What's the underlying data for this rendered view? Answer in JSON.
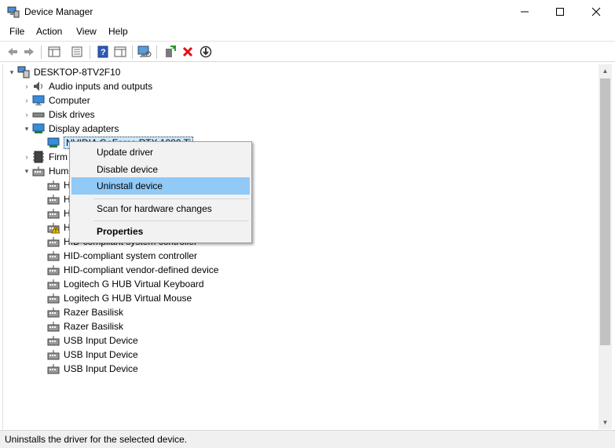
{
  "window": {
    "title": "Device Manager"
  },
  "menubar": {
    "items": [
      "File",
      "Action",
      "View",
      "Help"
    ]
  },
  "toolbar": {
    "buttons": [
      "back-arrow-icon",
      "forward-arrow-icon",
      "show-hide-console-tree-icon",
      "properties-icon",
      "help-icon",
      "action-pane-icon",
      "scan-hardware-icon",
      "update-driver-icon",
      "uninstall-icon",
      "disable-device-icon"
    ]
  },
  "tree": {
    "root": "DESKTOP-8TV2F10",
    "categories": [
      {
        "label": "Audio inputs and outputs",
        "icon": "speaker-icon",
        "expanded": false
      },
      {
        "label": "Computer",
        "icon": "monitor-icon",
        "expanded": false
      },
      {
        "label": "Disk drives",
        "icon": "disk-drive-icon",
        "expanded": false
      },
      {
        "label": "Display adapters",
        "icon": "display-adapter-icon",
        "expanded": true
      },
      {
        "label": "Firm",
        "icon": "firmware-icon",
        "expanded": false
      },
      {
        "label": "Hum",
        "icon": "hid-icon",
        "expanded": true
      }
    ],
    "display_adapter_child": "NVIDIA GeForce RTX 1080 Ti",
    "hid_children": [
      {
        "label": "HID-compliant consumer control device",
        "warning": false
      },
      {
        "label": "HID-compliant device",
        "warning": false
      },
      {
        "label": "HID-compliant device",
        "warning": false
      },
      {
        "label": "HID-compliant headset",
        "warning": true
      },
      {
        "label": "HID-compliant system controller",
        "warning": false
      },
      {
        "label": "HID-compliant system controller",
        "warning": false
      },
      {
        "label": "HID-compliant vendor-defined device",
        "warning": false
      },
      {
        "label": "Logitech G HUB Virtual Keyboard",
        "warning": false
      },
      {
        "label": "Logitech G HUB Virtual Mouse",
        "warning": false
      },
      {
        "label": "Razer Basilisk",
        "warning": false
      },
      {
        "label": "Razer Basilisk",
        "warning": false
      },
      {
        "label": "USB Input Device",
        "warning": false
      },
      {
        "label": "USB Input Device",
        "warning": false
      },
      {
        "label": "USB Input Device",
        "warning": false
      }
    ]
  },
  "context_menu": {
    "items": [
      "Update driver",
      "Disable device",
      "Uninstall device",
      "Scan for hardware changes",
      "Properties"
    ],
    "highlighted": "Uninstall device",
    "default_item": "Properties"
  },
  "status": {
    "text": "Uninstalls the driver for the selected device."
  },
  "colors": {
    "menu_highlight": "#91c9f7",
    "selection": "#cce8ff",
    "status_bg": "#f0f0f0"
  }
}
